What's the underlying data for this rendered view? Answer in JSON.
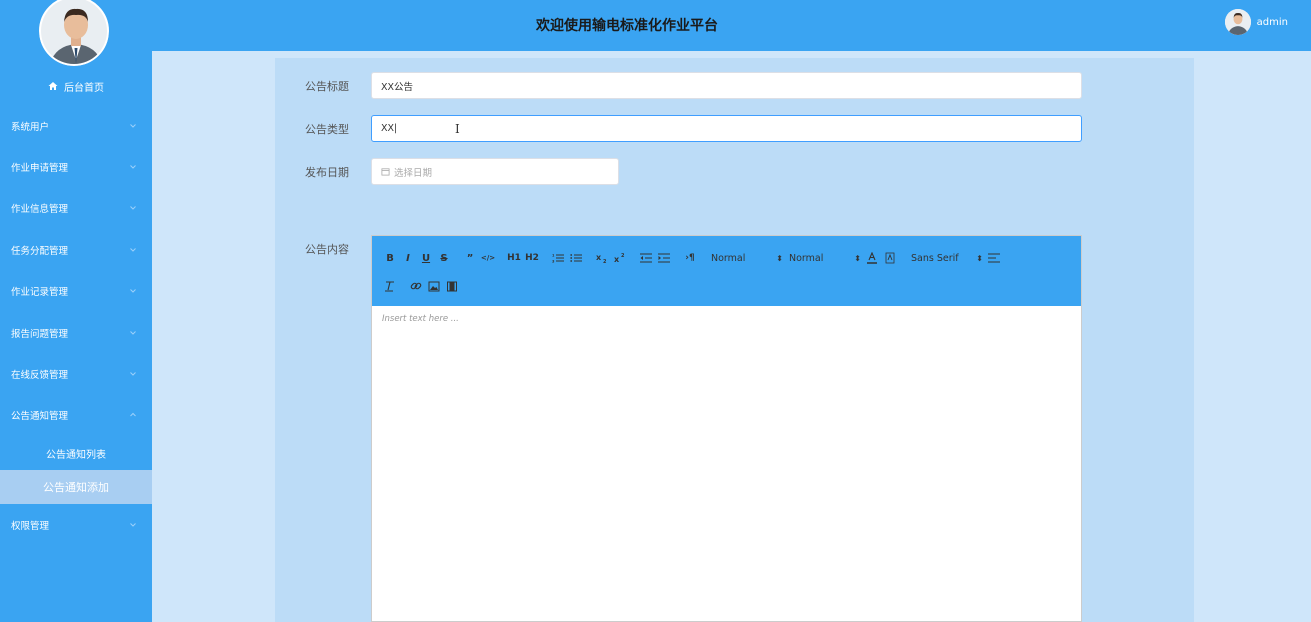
{
  "header": {
    "title": "欢迎使用输电标准化作业平台",
    "username": "admin"
  },
  "sidebar": {
    "home_label": "后台首页",
    "items": [
      {
        "label": "系统用户",
        "expanded": false
      },
      {
        "label": "作业申请管理",
        "expanded": false
      },
      {
        "label": "作业信息管理",
        "expanded": false
      },
      {
        "label": "任务分配管理",
        "expanded": false
      },
      {
        "label": "作业记录管理",
        "expanded": false
      },
      {
        "label": "报告问题管理",
        "expanded": false
      },
      {
        "label": "在线反馈管理",
        "expanded": false
      },
      {
        "label": "公告通知管理",
        "expanded": true
      }
    ],
    "subitems": [
      {
        "label": "公告通知列表",
        "active": false
      },
      {
        "label": "公告通知添加",
        "active": true
      }
    ],
    "last_item": {
      "label": "权限管理",
      "expanded": false
    }
  },
  "form": {
    "title_label": "公告标题",
    "title_value": "XX公告",
    "type_label": "公告类型",
    "type_value": "XX",
    "date_label": "发布日期",
    "date_placeholder": "选择日期",
    "content_label": "公告内容",
    "editor_placeholder": "Insert text here ..."
  },
  "toolbar": {
    "header_select": "Normal",
    "size_select": "Normal",
    "font_select": "Sans Serif",
    "buttons": [
      "B",
      "I",
      "U",
      "S",
      "”",
      "</>",
      "H1",
      "H2"
    ]
  },
  "colors": {
    "sidebar": "#3aa4f2",
    "header": "#3aa4f2",
    "panel": "#bcdcf7",
    "background": "#cfe6fa",
    "active_sub": "#a8cef2"
  }
}
